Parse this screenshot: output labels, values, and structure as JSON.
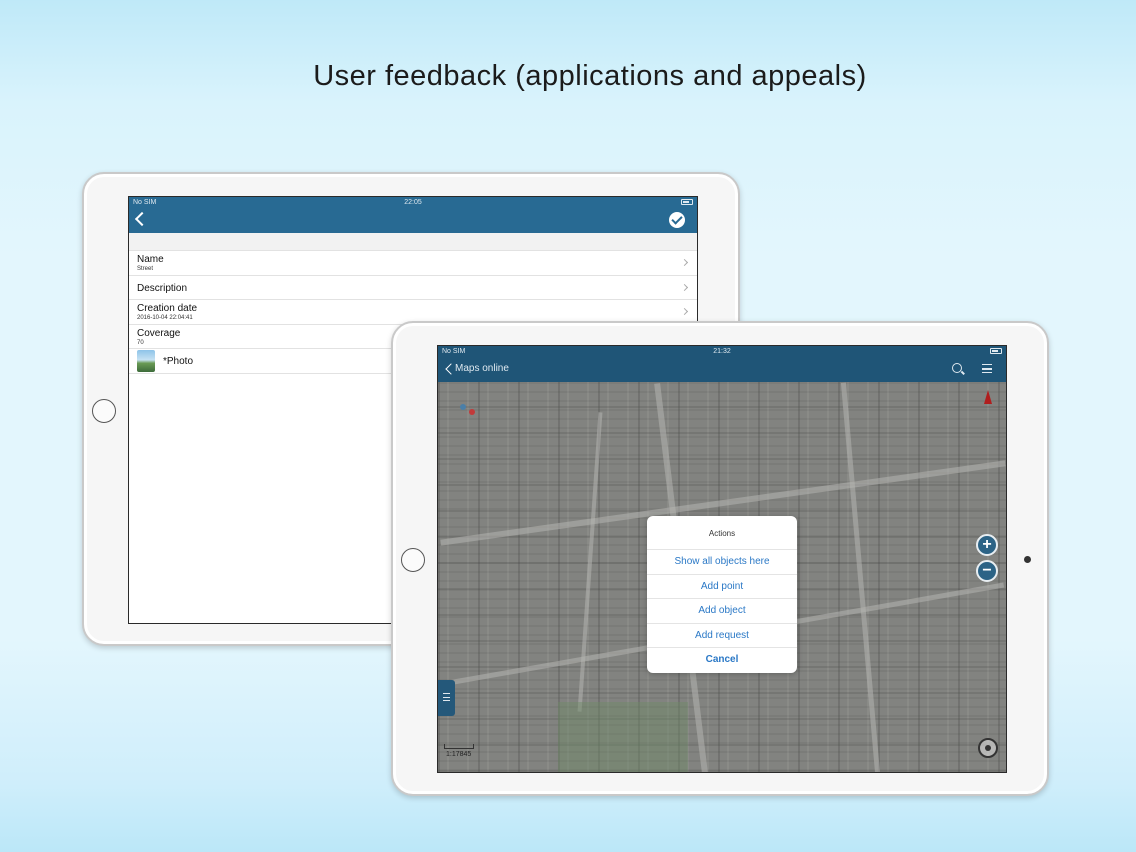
{
  "headline": "User feedback (applications and appeals)",
  "tablet_back": {
    "status": {
      "carrier": "No SIM",
      "time": "22:05"
    },
    "navbar": {
      "back_icon": "chevron-left-icon",
      "confirm_icon": "check-circle-icon"
    },
    "rows": [
      {
        "label": "Name",
        "value": "Street"
      },
      {
        "label": "Description",
        "value": ""
      },
      {
        "label": "Creation date",
        "value": "2016-10-04 22:04:41"
      },
      {
        "label": "Coverage",
        "value": "70"
      },
      {
        "label": "*Photo",
        "value": ""
      }
    ]
  },
  "tablet_front": {
    "status": {
      "carrier": "No SIM",
      "time": "21:32"
    },
    "navbar": {
      "back_label": "Maps online",
      "search_icon": "search-icon",
      "menu_icon": "menu-icon"
    },
    "map": {
      "zoom_in": "+",
      "zoom_out": "−",
      "scale": "1:17845"
    },
    "dialog": {
      "title": "Actions",
      "items": [
        "Show all objects here",
        "Add point",
        "Add object",
        "Add request"
      ],
      "cancel": "Cancel"
    }
  }
}
